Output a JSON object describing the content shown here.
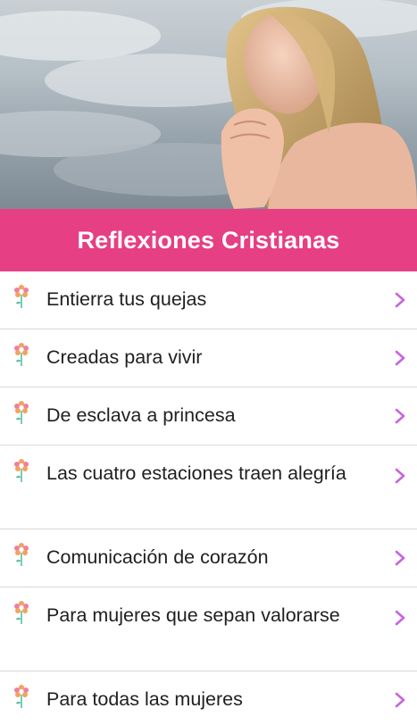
{
  "header": {
    "image_icon": "woman-praying-photo",
    "title": "Reflexiones Cristianas",
    "background_color": "#e63f84"
  },
  "list": {
    "item_icon": "flower-icon",
    "chevron_icon": "chevron-right-icon",
    "chevron_color": "#c764e0",
    "items": [
      {
        "label": "Entierra tus quejas"
      },
      {
        "label": "Creadas para vivir"
      },
      {
        "label": "De esclava a princesa"
      },
      {
        "label": "Las cuatro estaciones traen alegría"
      },
      {
        "label": "Comunicación de corazón"
      },
      {
        "label": "Para mujeres que sepan valorarse"
      },
      {
        "label": "Para todas las mujeres"
      }
    ]
  }
}
